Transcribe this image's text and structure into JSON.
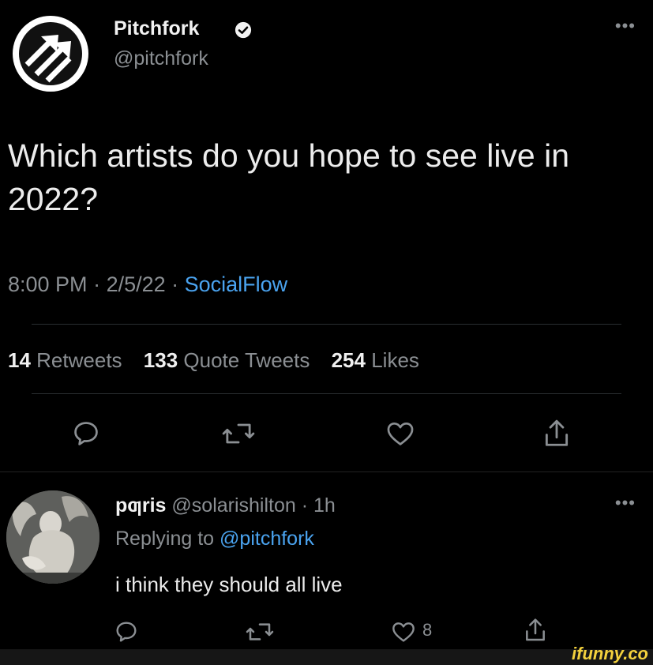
{
  "tweet": {
    "author_name": "Pitchfork",
    "author_handle": "@pitchfork",
    "more_label": "•••",
    "text": "Which artists do you hope to see live in 2022?",
    "time": "8:00 PM",
    "separator": " · ",
    "date": "2/5/22",
    "source": "SocialFlow",
    "stats": {
      "retweets_count": "14",
      "retweets_label": "Retweets",
      "quotes_count": "133",
      "quotes_label": "Quote Tweets",
      "likes_count": "254",
      "likes_label": "Likes"
    },
    "icons": [
      "comment-icon",
      "retweet-icon",
      "heart-icon",
      "share-icon"
    ]
  },
  "reply": {
    "author_name": "pƣris",
    "author_handle": "@solarishilton",
    "time": "1h",
    "separator": " · ",
    "replying_prefix": "Replying to",
    "replying_to": "@pitchfork",
    "text": "i think they should all live",
    "more_label": "•••",
    "like_count": "8"
  },
  "watermark": "ifunny.co",
  "colors": {
    "background": "#000000",
    "link": "#4aa3ef",
    "secondary_text": "#8b8f93",
    "watermark": "#f3d13d"
  }
}
